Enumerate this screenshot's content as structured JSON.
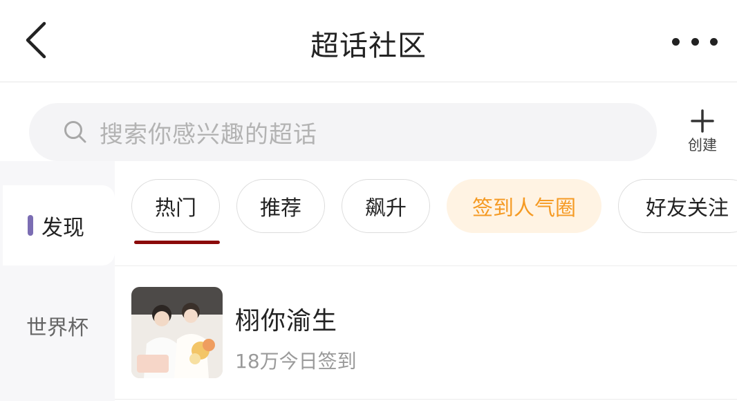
{
  "header": {
    "title": "超话社区"
  },
  "search": {
    "placeholder": "搜索你感兴趣的超话"
  },
  "create": {
    "label": "创建"
  },
  "sidebar": {
    "items": [
      {
        "label": "发现",
        "active": true
      },
      {
        "label": "世界杯",
        "active": false
      }
    ]
  },
  "chips": [
    {
      "label": "热门"
    },
    {
      "label": "推荐"
    },
    {
      "label": "飙升"
    },
    {
      "label": "签到人气圈",
      "active": true
    },
    {
      "label": "好友关注"
    }
  ],
  "list": [
    {
      "name": "栩你渝生",
      "meta": "18万今日签到"
    }
  ],
  "colors": {
    "accent": "#f59a23",
    "chip_active_bg": "#fff3e3",
    "side_marker": "#7b6db3"
  },
  "icons": [
    "back-arrow-icon",
    "more-dots-icon",
    "search-icon",
    "plus-icon"
  ]
}
